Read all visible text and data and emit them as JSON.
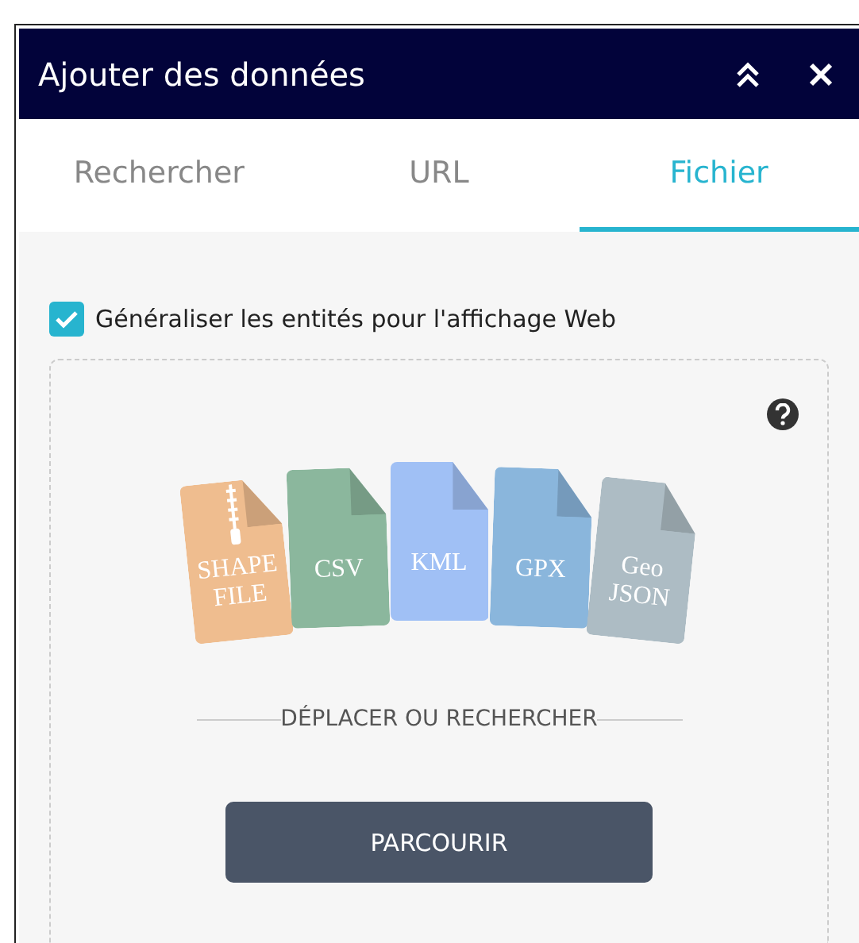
{
  "window": {
    "title": "Ajouter des données"
  },
  "tabs": [
    {
      "label": "Rechercher",
      "selected": false
    },
    {
      "label": "URL",
      "selected": false
    },
    {
      "label": "Fichier",
      "selected": true
    }
  ],
  "generalize": {
    "label": "Généraliser les entités pour l'affichage Web",
    "checked": true
  },
  "file_types": [
    {
      "label": "SHAPE FILE",
      "color": "#efbd8f",
      "kind": "zip"
    },
    {
      "label": "CSV",
      "color": "#8bb79d",
      "kind": "plain"
    },
    {
      "label": "KML",
      "color": "#a0c0f5",
      "kind": "plain"
    },
    {
      "label": "GPX",
      "color": "#8ab6dc",
      "kind": "plain"
    },
    {
      "label": "Geo JSON",
      "color": "#adbcc4",
      "kind": "plain"
    }
  ],
  "drop_label": "DÉPLACER OU RECHERCHER",
  "browse_button": "PARCOURIR"
}
